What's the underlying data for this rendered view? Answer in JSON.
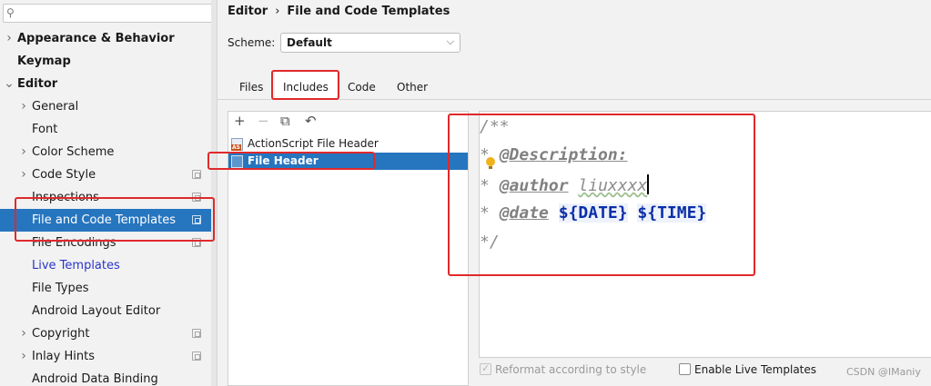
{
  "search": {
    "placeholder": "",
    "icon": "search-icon"
  },
  "sidebar": {
    "items": [
      {
        "label": "Appearance & Behavior",
        "chevron": "›",
        "bold": true
      },
      {
        "label": "Keymap",
        "chevron": "",
        "bold": true
      },
      {
        "label": "Editor",
        "chevron": "⌄",
        "bold": true
      },
      {
        "label": "General",
        "chevron": "›"
      },
      {
        "label": "Font",
        "chevron": ""
      },
      {
        "label": "Color Scheme",
        "chevron": "›"
      },
      {
        "label": "Code Style",
        "chevron": "›"
      },
      {
        "label": "Inspections",
        "chevron": ""
      },
      {
        "label": "File and Code Templates",
        "chevron": "",
        "selected": true
      },
      {
        "label": "File Encodings",
        "chevron": ""
      },
      {
        "label": "Live Templates",
        "chevron": ""
      },
      {
        "label": "File Types",
        "chevron": ""
      },
      {
        "label": "Android Layout Editor",
        "chevron": ""
      },
      {
        "label": "Copyright",
        "chevron": "›"
      },
      {
        "label": "Inlay Hints",
        "chevron": "›"
      },
      {
        "label": "Android Data Binding",
        "chevron": ""
      }
    ]
  },
  "breadcrumb": {
    "parent": "Editor",
    "separator": "›",
    "current": "File and Code Templates"
  },
  "scheme": {
    "label": "Scheme:",
    "value": "Default",
    "dropdown_icon": "chevron-down-icon"
  },
  "tabs": [
    {
      "label": "Files"
    },
    {
      "label": "Includes",
      "active": true
    },
    {
      "label": "Code"
    },
    {
      "label": "Other"
    }
  ],
  "toolbar": {
    "add": "+",
    "remove": "−",
    "copy": "⧉",
    "reset": "↶"
  },
  "templates": [
    {
      "label": "ActionScript File Header",
      "icon_tag": "AS"
    },
    {
      "label": "File Header",
      "selected": true
    }
  ],
  "editor": {
    "line1": "/**",
    "line2_star": "* ",
    "line2_tag": "@Description:",
    "line3_star": "* ",
    "line3_tag": "@author",
    "line3_value": "liuxxxx",
    "line4_star": "* ",
    "line4_tag": "@date",
    "line4_var1": "${DATE}",
    "line4_var2": "${TIME}",
    "line5": "*/"
  },
  "bottom": {
    "reformat": "Reformat according to style",
    "enable_live": "Enable Live Templates"
  },
  "watermark": "CSDN @IManiy",
  "colors": {
    "selection": "#2675bf",
    "annotation": "#e0292b",
    "variable": "#0b2ea8"
  }
}
